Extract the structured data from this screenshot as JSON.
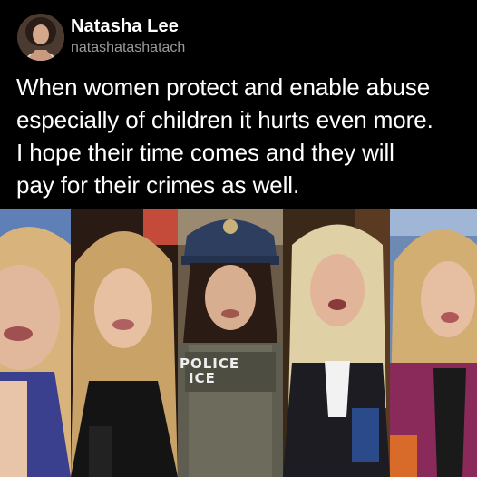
{
  "post": {
    "author_name": "Natasha Lee",
    "author_handle": "natashatashatach",
    "text_lines": [
      "When women protect and enable abuse",
      "especially of children it hurts even more.",
      "I hope their time comes and they will",
      "pay for their crimes as well."
    ]
  },
  "image": {
    "vest_text_line1": "POLICE",
    "vest_text_line2": "ICE",
    "panels": [
      "woman-1",
      "woman-2",
      "woman-3",
      "woman-4",
      "woman-5"
    ]
  }
}
